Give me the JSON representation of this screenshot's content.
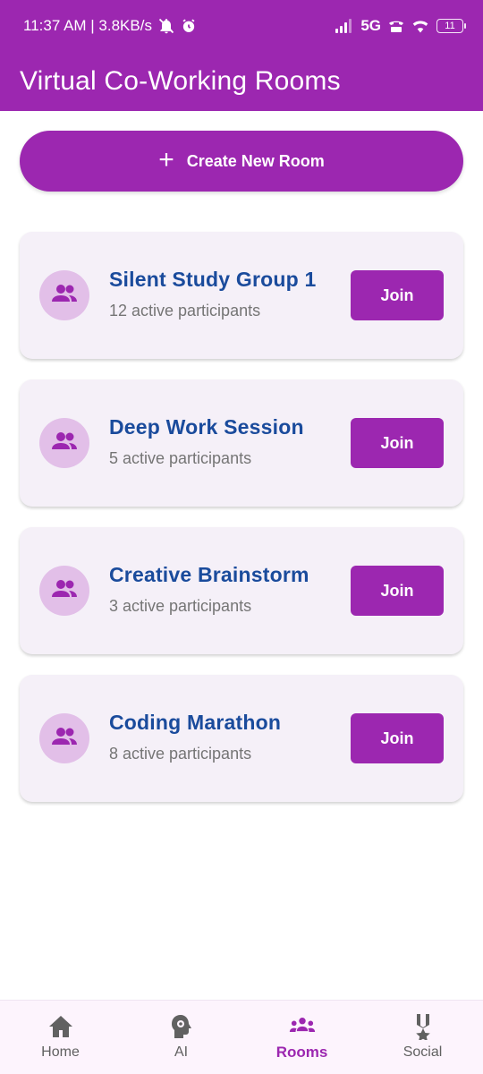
{
  "status_bar": {
    "time_info": "11:37 AM | 3.8KB/s",
    "network": "5G",
    "battery": "11"
  },
  "app_bar": {
    "title": "Virtual Co-Working Rooms"
  },
  "create_button": {
    "label": "Create New Room"
  },
  "rooms": [
    {
      "name": "Silent Study Group 1",
      "participants": "12 active participants",
      "join_label": "Join"
    },
    {
      "name": "Deep Work Session",
      "participants": "5 active participants",
      "join_label": "Join"
    },
    {
      "name": "Creative Brainstorm",
      "participants": "3 active participants",
      "join_label": "Join"
    },
    {
      "name": "Coding Marathon",
      "participants": "8 active participants",
      "join_label": "Join"
    }
  ],
  "bottom_nav": {
    "items": [
      {
        "label": "Home",
        "icon": "home-icon"
      },
      {
        "label": "AI",
        "icon": "ai-head-gear-icon"
      },
      {
        "label": "Rooms",
        "icon": "groups-icon",
        "active": true
      },
      {
        "label": "Social",
        "icon": "medal-icon"
      }
    ]
  },
  "colors": {
    "primary": "#9c27b0",
    "room_title": "#1a4b9c",
    "card_bg": "#f5f0f8",
    "avatar_bg": "#e2bfe8"
  }
}
